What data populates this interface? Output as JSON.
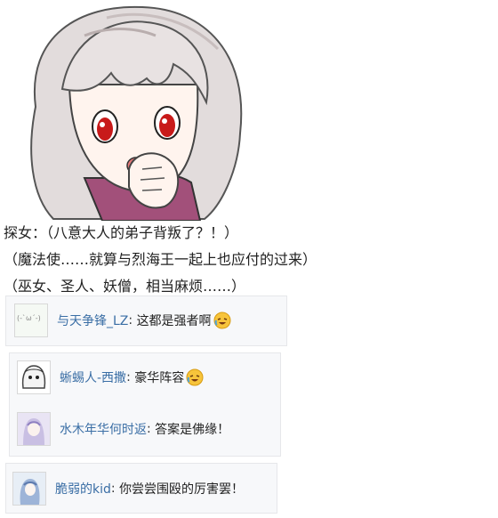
{
  "story": {
    "line1": "探女：（八意大人的弟子背叛了？！）",
    "line2": "（魔法使……就算与烈海王一起上也应付的过来）",
    "line3": "（巫女、圣人、妖僧，相当麻烦……）"
  },
  "comments": [
    {
      "user": "与天争锋_LZ",
      "text": "这都是强者啊",
      "emoji": "crying-laugh-emoji",
      "avatar_text": "(-`ω´-)"
    },
    {
      "user": "蜥蜴人-西撒",
      "text": "豪华阵容",
      "emoji": "crying-laugh-emoji"
    },
    {
      "user": "水木年华何时返",
      "text": "答案是佛缘！"
    },
    {
      "user": "脆弱的kid",
      "text": "你尝尝围殴的厉害罢！"
    }
  ],
  "colors": {
    "username": "#3a6ea5",
    "panel_bg": "#f7f8fa",
    "panel_border": "#e6e7ea"
  },
  "icons": [
    "character-portrait",
    "crying-laugh-emoji",
    "user-avatar"
  ]
}
